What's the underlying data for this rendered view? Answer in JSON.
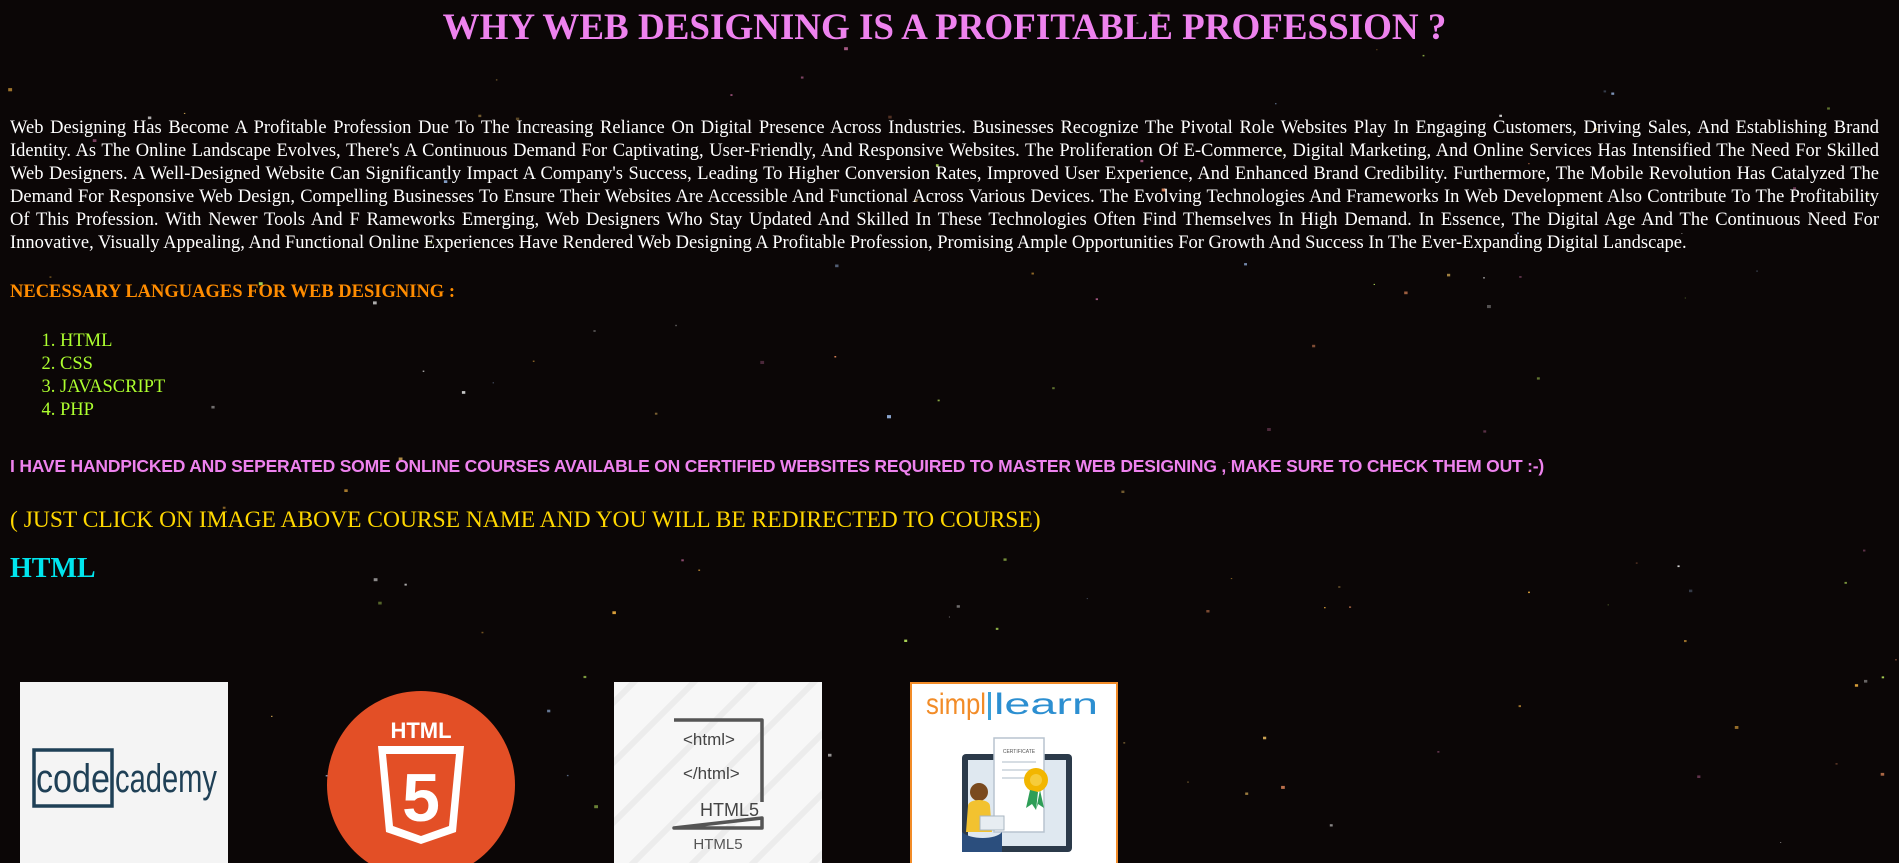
{
  "page": {
    "title": "WHY WEB DESIGNING IS A PROFITABLE PROFESSION ?",
    "intro": "Web Designing Has Become A Profitable Profession Due To The Increasing Reliance On Digital Presence Across Industries. Businesses Recognize The Pivotal Role Websites Play In Engaging Customers, Driving Sales, And Establishing Brand Identity. As The Online Landscape Evolves, There's A Continuous Demand For Captivating, User-Friendly, And Responsive Websites. The Proliferation Of E-Commerce, Digital Marketing, And Online Services Has Intensified The Need For Skilled Web Designers. A Well-Designed Website Can Significantly Impact A Company's Success, Leading To Higher Conversion Rates, Improved User Experience, And Enhanced Brand Credibility. Furthermore, The Mobile Revolution Has Catalyzed The Demand For Responsive Web Design, Compelling Businesses To Ensure Their Websites Are Accessible And Functional Across Various Devices. The Evolving Technologies And Frameworks In Web Development Also Contribute To The Profitability Of This Profession. With Newer Tools And F Rameworks Emerging, Web Designers Who Stay Updated And Skilled In These Technologies Often Find Themselves In High Demand. In Essence, The Digital Age And The Continuous Need For Innovative, Visually Appealing, And Functional Online Experiences Have Rendered Web Designing A Profitable Profession, Promising Ample Opportunities For Growth And Success In The Ever-Expanding Digital Landscape.",
    "languages_heading": "NECESSARY LANGUAGES FOR WEB DESIGNING :",
    "languages": [
      "HTML",
      "CSS",
      "JAVASCRIPT",
      "PHP"
    ],
    "handpicked_note": "I HAVE HANDPICKED AND SEPERATED SOME ONLINE COURSES AVAILABLE ON CERTIFIED WEBSITES REQUIRED TO MASTER WEB DESIGNING , MAKE SURE TO CHECK THEM OUT :-)",
    "click_note": "( JUST CLICK ON IMAGE ABOVE COURSE NAME AND YOU WILL BE REDIRECTED TO COURSE)",
    "section_heading": "HTML"
  },
  "courses": [
    {
      "logo_parts": [
        "code",
        "cademy"
      ],
      "icon": "codecademy-logo"
    },
    {
      "logo_parts": [
        "HTML",
        "5"
      ],
      "icon": "html5-shield-logo"
    },
    {
      "logo_parts": [
        "<html>",
        "</html>",
        "HTML5",
        "HTML5"
      ],
      "icon": "html5-document-logo"
    },
    {
      "logo_parts": [
        "simpl",
        "learn",
        "CERTIFICATE"
      ],
      "icon": "simplilearn-certificate-logo"
    }
  ],
  "colors": {
    "background": "#0b0606",
    "title": "#ee82ee",
    "languages_heading": "#ff8c00",
    "languages_list": "#adff2f",
    "handpicked_note": "#ee82ee",
    "click_note": "#ffd700",
    "section_heading": "#00e5ee",
    "html5_orange": "#e34f26",
    "codecademy_navy": "#1f4056",
    "simplilearn_orange": "#f28c28"
  }
}
